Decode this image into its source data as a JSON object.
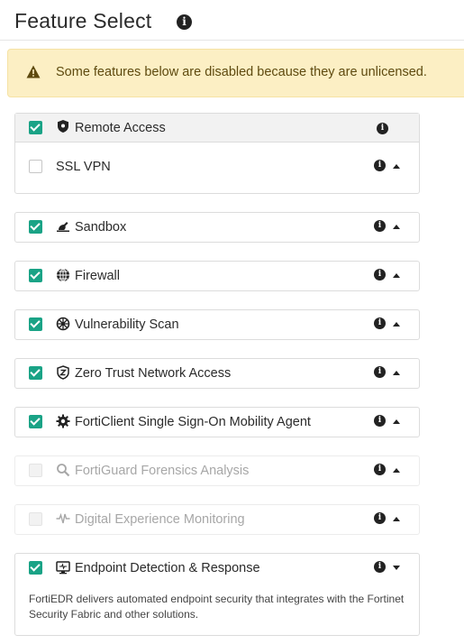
{
  "header": {
    "title": "Feature Select",
    "info_icon": "info-circle-icon"
  },
  "notice": {
    "icon": "warning-triangle-icon",
    "text": "Some features below are disabled because they are unlicensed."
  },
  "groups": {
    "remote_access": {
      "label": "Remote Access",
      "checked": true,
      "icon": "shield-icon",
      "children": {
        "ssl_vpn": {
          "label": "SSL VPN",
          "checked": false
        }
      }
    },
    "sandbox": {
      "label": "Sandbox",
      "checked": true,
      "icon": "sandbox-icon"
    },
    "firewall": {
      "label": "Firewall",
      "checked": true,
      "icon": "firewall-globe-icon"
    },
    "vulnerability_scan": {
      "label": "Vulnerability Scan",
      "checked": true,
      "icon": "crosshair-icon"
    },
    "ztna": {
      "label": "Zero Trust Network Access",
      "checked": true,
      "icon": "ztna-shield-icon"
    },
    "sso": {
      "label": "FortiClient Single Sign-On Mobility Agent",
      "checked": true,
      "icon": "gear-icon"
    },
    "forensics": {
      "label": "FortiGuard Forensics Analysis",
      "checked": false,
      "disabled": true,
      "icon": "magnifier-icon"
    },
    "dem": {
      "label": "Digital Experience Monitoring",
      "checked": false,
      "disabled": true,
      "icon": "pulse-icon"
    },
    "edr": {
      "label": "Endpoint Detection & Response",
      "checked": true,
      "icon": "monitor-icon",
      "expanded": true,
      "description": "FortiEDR delivers automated endpoint security that integrates with the Fortinet Security Fabric and other solutions."
    }
  },
  "colors": {
    "accent": "#1aa386",
    "warning_bg": "#fcefc4",
    "warning_text": "#5e4a0f"
  }
}
